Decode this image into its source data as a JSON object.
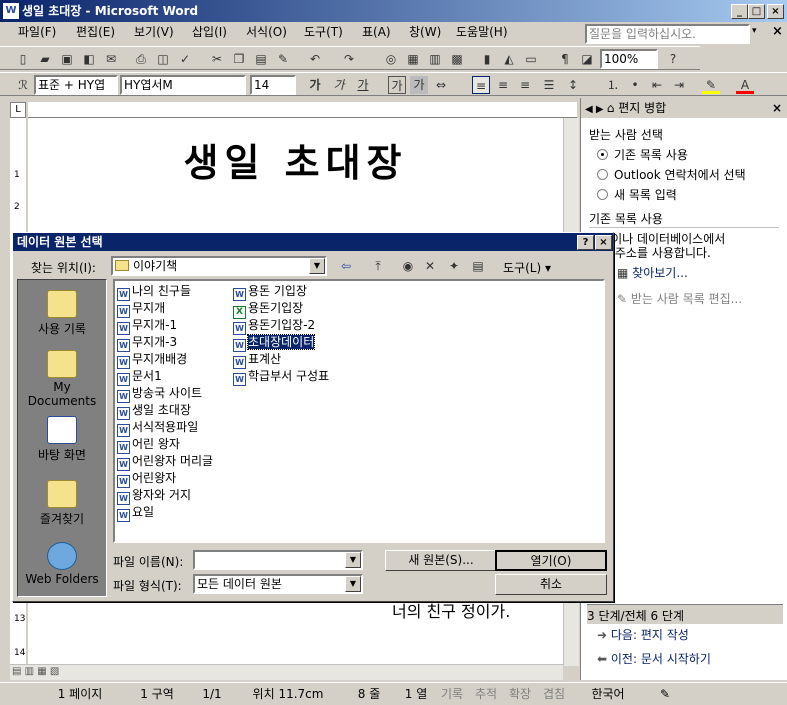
{
  "window": {
    "title": "생일 초대장 - Microsoft Word",
    "min_label": "_",
    "max_label": "□",
    "close_label": "×"
  },
  "menu": {
    "items": [
      "파일(F)",
      "편집(E)",
      "보기(V)",
      "삽입(I)",
      "서식(O)",
      "도구(T)",
      "표(A)",
      "창(W)",
      "도움말(H)"
    ],
    "help_placeholder": "질문을 입력하십시오."
  },
  "toolbar": {
    "zoom": "100%",
    "style": "표준 + HY엽",
    "font": "HY엽서M",
    "size": "14",
    "format_labels": [
      "가",
      "가",
      "가",
      "가",
      "가"
    ]
  },
  "document": {
    "heading": "생일 초대장",
    "body_fragment": "너의 친구 정이가.",
    "ruler_v_labels": [
      "1",
      "2",
      "13",
      "14"
    ]
  },
  "taskpane": {
    "title": "편지 병합",
    "section_select": "받는 사람 선택",
    "options": [
      {
        "label": "기존 목록 사용",
        "selected": true
      },
      {
        "label": "Outlook 연락처에서 선택",
        "selected": false
      },
      {
        "label": "새 목록 입력",
        "selected": false
      }
    ],
    "section_existing": "기존 목록 사용",
    "desc_line1": "파일이나 데이터베이스에서",
    "desc_line2": "름과 주소를 사용합니다.",
    "browse_link": "찾아보기...",
    "edit_link": "받는 사람 목록 편집...",
    "step": "3 단계/전체  6 단계",
    "next_link": "다음: 편지 작성",
    "prev_link": "이전: 문서 시작하기"
  },
  "dialog": {
    "title": "데이터 원본 선택",
    "help_label": "?",
    "close_label": "×",
    "lookin_label": "찾는 위치(I):",
    "lookin_value": "이야기책",
    "tools_label": "도구(L) ▾",
    "places": [
      "사용 기록",
      "My Documents",
      "바탕 화면",
      "즐겨찾기",
      "Web Folders"
    ],
    "files_col1": [
      {
        "name": "나의 친구들",
        "type": "word"
      },
      {
        "name": "무지개",
        "type": "word"
      },
      {
        "name": "무지개-1",
        "type": "word"
      },
      {
        "name": "무지개-3",
        "type": "word"
      },
      {
        "name": "무지개배경",
        "type": "word"
      },
      {
        "name": "문서1",
        "type": "word"
      },
      {
        "name": "방송국 사이트",
        "type": "word"
      },
      {
        "name": "생일 초대장",
        "type": "word"
      },
      {
        "name": "서식적용파일",
        "type": "word"
      },
      {
        "name": "어린 왕자",
        "type": "word"
      },
      {
        "name": "어린왕자 머리글",
        "type": "word"
      },
      {
        "name": "어린왕자",
        "type": "word"
      },
      {
        "name": "왕자와 거지",
        "type": "word"
      },
      {
        "name": "요일",
        "type": "word"
      }
    ],
    "files_col2": [
      {
        "name": "용돈 기입장",
        "type": "word"
      },
      {
        "name": "용돈기입장",
        "type": "excel"
      },
      {
        "name": "용돈기입장-2",
        "type": "word"
      },
      {
        "name": "초대장데이터",
        "type": "word",
        "selected": true
      },
      {
        "name": "표계산",
        "type": "word"
      },
      {
        "name": "학급부서 구성표",
        "type": "word"
      }
    ],
    "filename_label": "파일 이름(N):",
    "filename_value": "",
    "filetype_label": "파일 형식(T):",
    "filetype_value": "모든 데이터 원본",
    "new_source_button": "새 원본(S)...",
    "open_button": "열기(O)",
    "cancel_button": "취소"
  },
  "status": {
    "page": "1 페이지",
    "section": "1 구역",
    "pages": "1/1",
    "position": "위치 11.7cm",
    "line": "8 줄",
    "col": "1 열",
    "rec": "기록",
    "trk": "추적",
    "ext": "확장",
    "ovr": "겹침",
    "lang": "한국어"
  }
}
